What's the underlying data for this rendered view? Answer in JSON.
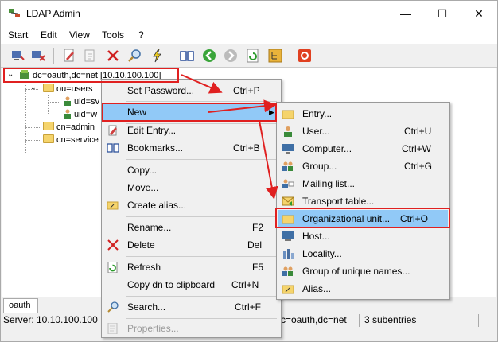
{
  "window": {
    "title": "LDAP Admin",
    "minimize": "—",
    "maximize": "☐",
    "close": "✕"
  },
  "menu": [
    "Start",
    "Edit",
    "View",
    "Tools",
    "?"
  ],
  "toolbar_icons": [
    "connect-icon",
    "disconnect-icon",
    "edit-icon",
    "properties-icon",
    "delete-icon",
    "search-icon",
    "lightning-icon",
    "bookmarks-icon",
    "back-icon",
    "forward-icon",
    "refresh-icon",
    "tree-icon",
    "exit-icon"
  ],
  "tree": {
    "root": "dc=oauth,dc=net [10.10.100.100]",
    "nodes": [
      {
        "label": "ou=users",
        "type": "folder"
      },
      {
        "label": "uid=sv",
        "type": "user"
      },
      {
        "label": "uid=w",
        "type": "user"
      },
      {
        "label": "cn=admin",
        "type": "folder"
      },
      {
        "label": "cn=service",
        "type": "folder"
      }
    ]
  },
  "tab": "oauth",
  "status": {
    "server": "Server: 10.10.100.100",
    "dn": "c=oauth,dc=net",
    "subentries": "3 subentries"
  },
  "context_menu": [
    {
      "label": "Set Password...",
      "shortcut": "Ctrl+P",
      "icon": ""
    },
    {
      "label": "New",
      "shortcut": "",
      "icon": "",
      "submenu": true
    },
    {
      "label": "Edit Entry...",
      "shortcut": "",
      "icon": "edit-icon"
    },
    {
      "label": "Bookmarks...",
      "shortcut": "Ctrl+B",
      "icon": "bookmarks-icon"
    },
    {
      "label": "Copy...",
      "shortcut": "",
      "icon": ""
    },
    {
      "label": "Move...",
      "shortcut": "",
      "icon": ""
    },
    {
      "label": "Create alias...",
      "shortcut": "",
      "icon": "alias-icon"
    },
    {
      "label": "Rename...",
      "shortcut": "F2",
      "icon": ""
    },
    {
      "label": "Delete",
      "shortcut": "Del",
      "icon": "delete-icon"
    },
    {
      "label": "Refresh",
      "shortcut": "F5",
      "icon": "refresh-icon"
    },
    {
      "label": "Copy dn to clipboard",
      "shortcut": "Ctrl+N",
      "icon": ""
    },
    {
      "label": "Search...",
      "shortcut": "Ctrl+F",
      "icon": "search-icon"
    },
    {
      "label": "Properties...",
      "shortcut": "",
      "icon": "properties-icon",
      "disabled": true
    }
  ],
  "submenu": [
    {
      "label": "Entry...",
      "shortcut": "",
      "icon": "folder-icon"
    },
    {
      "label": "User...",
      "shortcut": "Ctrl+U",
      "icon": "user-icon"
    },
    {
      "label": "Computer...",
      "shortcut": "Ctrl+W",
      "icon": "computer-icon"
    },
    {
      "label": "Group...",
      "shortcut": "Ctrl+G",
      "icon": "group-icon"
    },
    {
      "label": "Mailing list...",
      "shortcut": "",
      "icon": "mailing-list-icon"
    },
    {
      "label": "Transport table...",
      "shortcut": "",
      "icon": "transport-icon"
    },
    {
      "label": "Organizational unit...",
      "shortcut": "Ctrl+O",
      "icon": "folder-icon",
      "highlighted": true
    },
    {
      "label": "Host...",
      "shortcut": "",
      "icon": "host-icon"
    },
    {
      "label": "Locality...",
      "shortcut": "",
      "icon": "locality-icon"
    },
    {
      "label": "Group of unique names...",
      "shortcut": "",
      "icon": "group-icon"
    },
    {
      "label": "Alias...",
      "shortcut": "",
      "icon": "alias-icon"
    }
  ],
  "colors": {
    "highlight": "#91c9f7",
    "annotation": "#e02020",
    "folder": "#f5d46c"
  }
}
